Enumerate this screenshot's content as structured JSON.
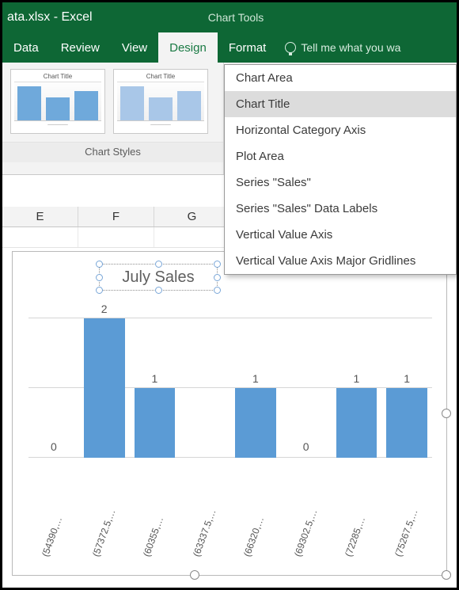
{
  "titlebar": {
    "filename": "ata.xlsx - Excel",
    "context_tab": "Chart Tools"
  },
  "tabs": {
    "data": "Data",
    "review": "Review",
    "view": "View",
    "design": "Design",
    "format": "Format",
    "tellme": "Tell me what you wa"
  },
  "ribbon": {
    "styles_label": "Chart Styles",
    "thumb_title": "Chart Title"
  },
  "menu": {
    "items": [
      "Chart Area",
      "Chart Title",
      "Horizontal Category Axis",
      "Plot Area",
      "Series \"Sales\"",
      "Series \"Sales\" Data Labels",
      "Vertical Value Axis",
      "Vertical Value Axis Major Gridlines"
    ],
    "highlighted_index": 1
  },
  "columns": [
    "E",
    "F",
    "G"
  ],
  "chart_title": "July Sales",
  "chart_data": {
    "type": "bar",
    "title": "July Sales",
    "categories": [
      "(54390,…",
      "(57372.5,…",
      "(60355,…",
      "(63337.5,…",
      "(66320,…",
      "(69302.5,…",
      "(72285,…",
      "(75267.5,…"
    ],
    "values": [
      0,
      2,
      1,
      0,
      1,
      0,
      1,
      1
    ],
    "data_labels": [
      "0",
      "2",
      "1",
      "",
      "1",
      "0",
      "1",
      "1"
    ],
    "ylim": [
      0,
      2
    ],
    "xlabel": "",
    "ylabel": ""
  }
}
